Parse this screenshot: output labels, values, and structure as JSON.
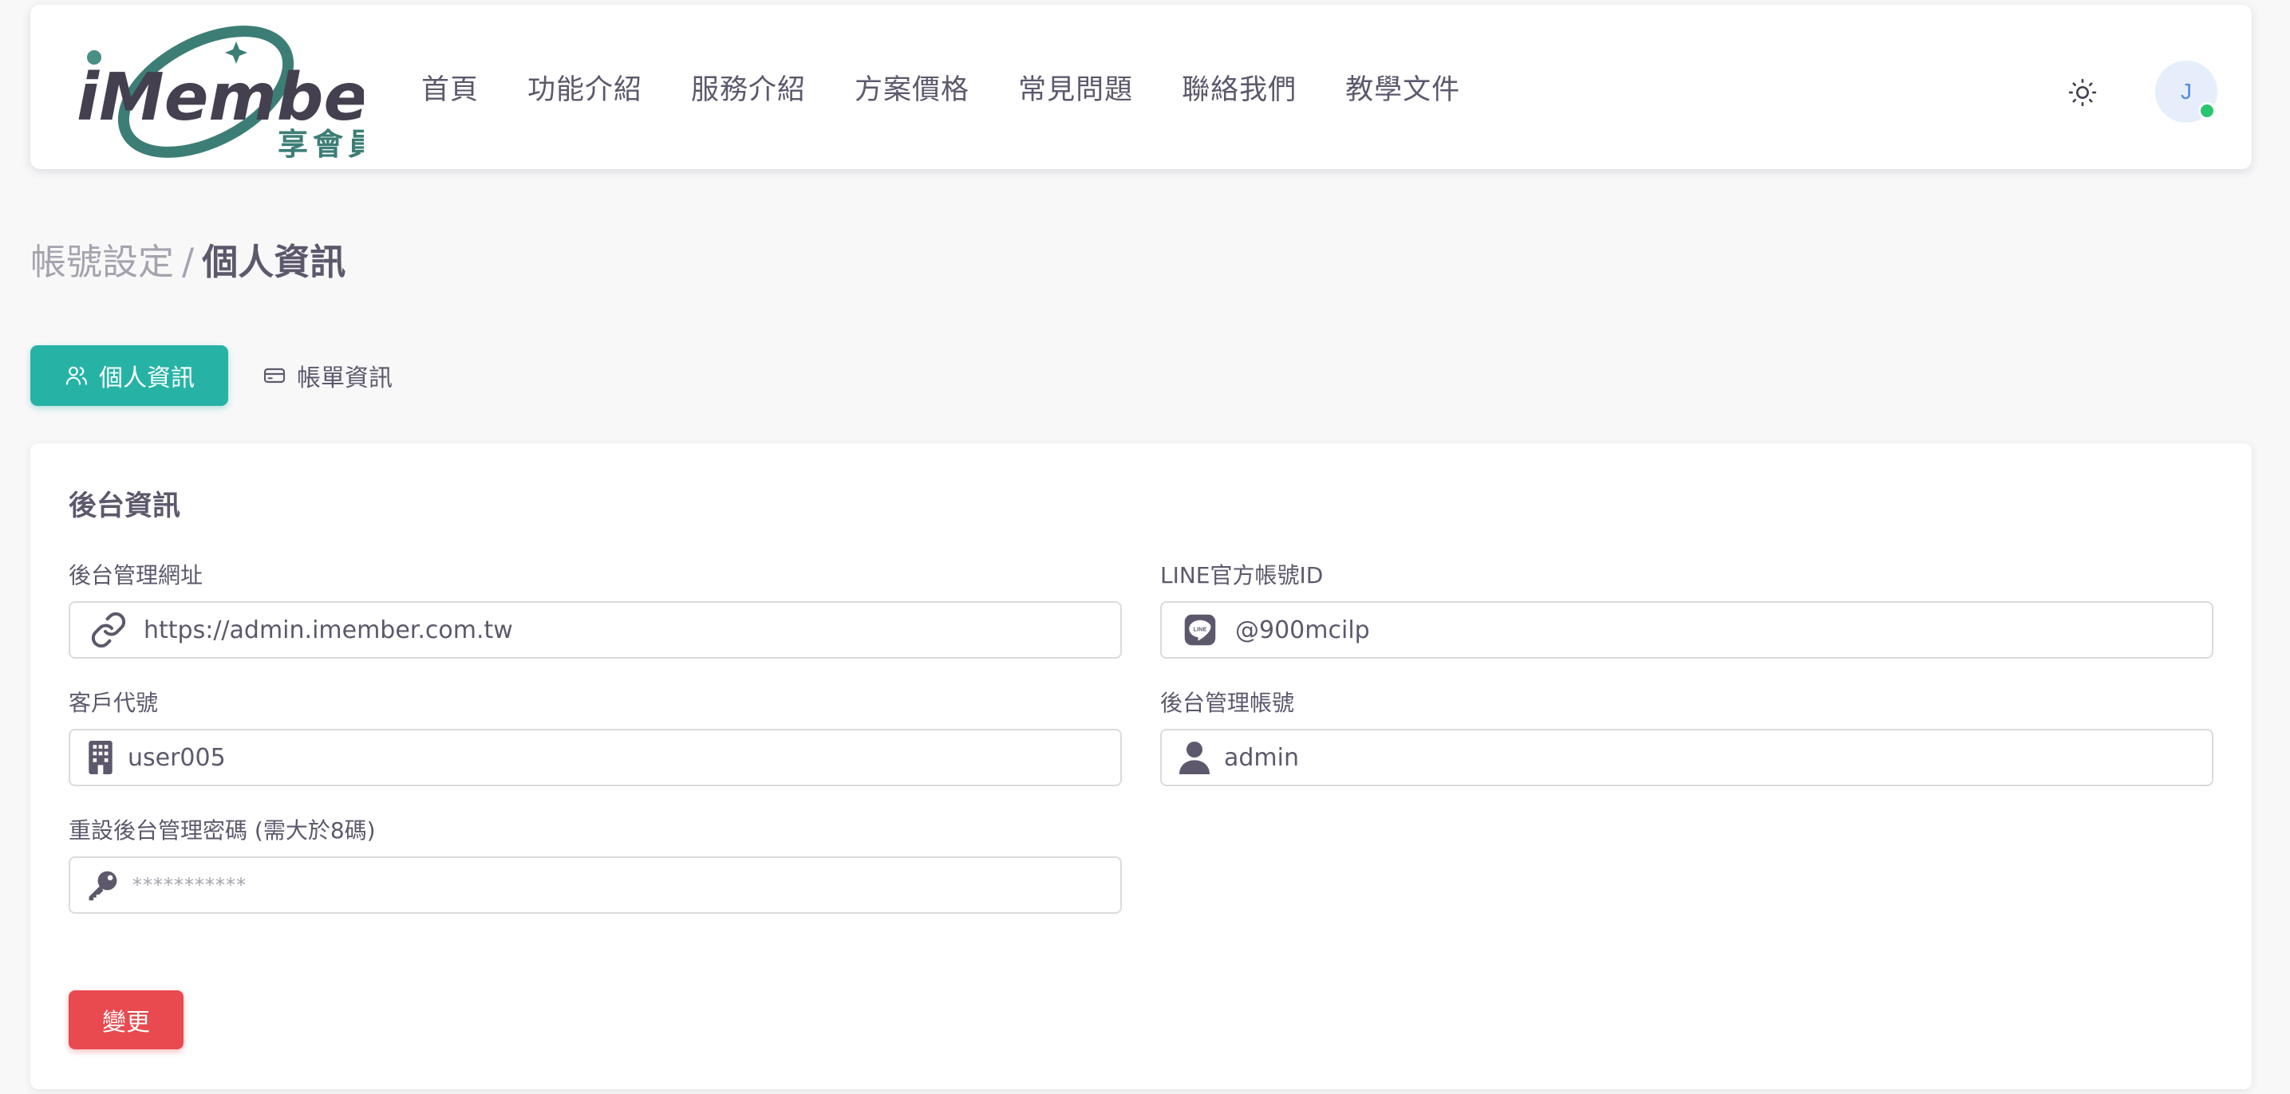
{
  "brand": {
    "logo_text": "iMember",
    "logo_subtext": "享會員",
    "accent_color": "#26b3a6",
    "logo_color": "#3c7e75"
  },
  "nav": {
    "items": [
      {
        "label": "首頁"
      },
      {
        "label": "功能介紹"
      },
      {
        "label": "服務介紹"
      },
      {
        "label": "方案價格"
      },
      {
        "label": "常見問題"
      },
      {
        "label": "聯絡我們"
      },
      {
        "label": "教學文件"
      }
    ],
    "theme_icon": "sun-icon",
    "avatar_initial": "J",
    "avatar_status_color": "#28c76f"
  },
  "breadcrumb": {
    "parent": "帳號設定",
    "separator": "/",
    "current": "個人資訊"
  },
  "tabs": [
    {
      "label": "個人資訊",
      "icon": "users-icon",
      "active": true
    },
    {
      "label": "帳單資訊",
      "icon": "credit-card-icon",
      "active": false
    }
  ],
  "card": {
    "title": "後台資訊",
    "fields": {
      "admin_url": {
        "label": "後台管理網址",
        "value": "https://admin.imember.com.tw",
        "icon": "link-icon"
      },
      "line_id": {
        "label": "LINE官方帳號ID",
        "value": "@900mcilp",
        "icon": "line-icon"
      },
      "customer_code": {
        "label": "客戶代號",
        "value": "user005",
        "icon": "building-icon"
      },
      "admin_account": {
        "label": "後台管理帳號",
        "value": "admin",
        "icon": "user-icon"
      },
      "reset_password": {
        "label": "重設後台管理密碼 (需大於8碼)",
        "placeholder": "***********",
        "icon": "key-icon"
      }
    },
    "submit_label": "變更",
    "submit_color": "#e84a4f"
  }
}
